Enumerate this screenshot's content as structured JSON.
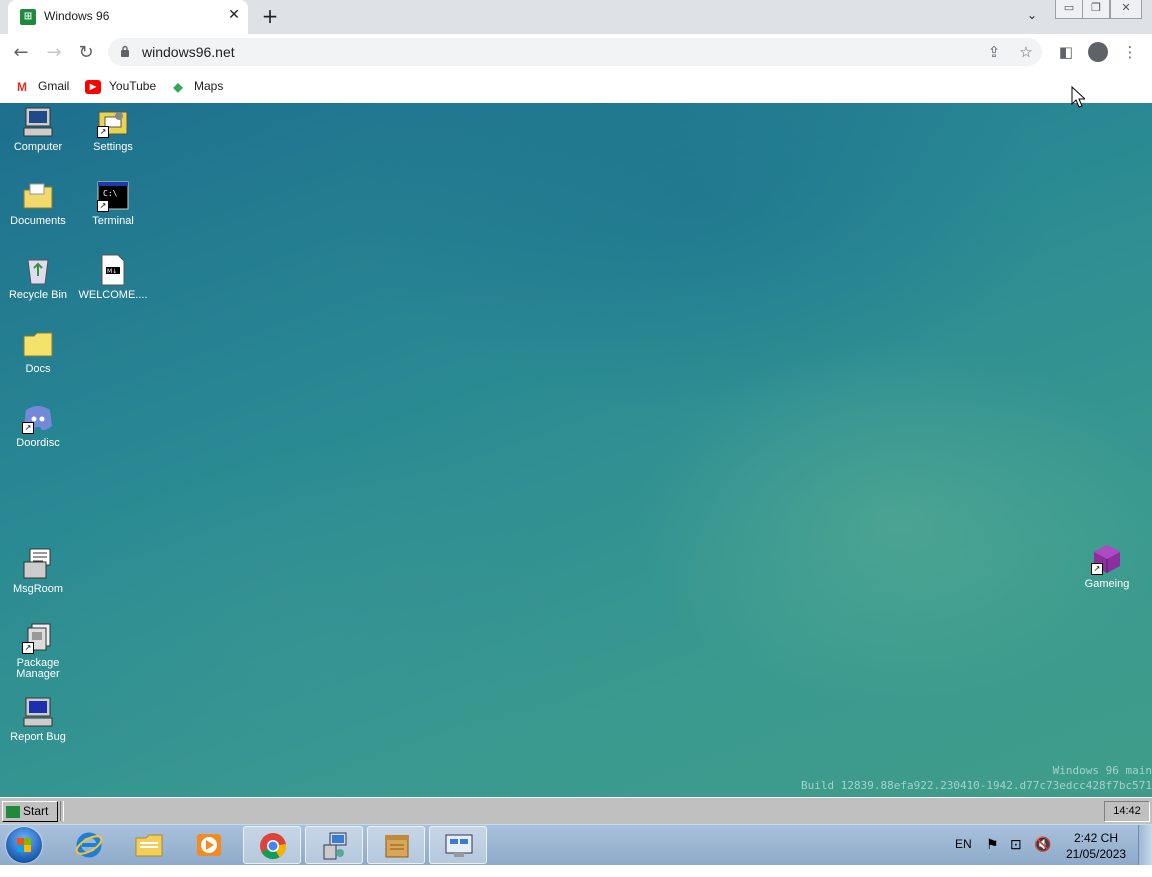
{
  "browser": {
    "tab_title": "Windows 96",
    "tab_close": "✕",
    "new_tab": "+",
    "url": "windows96.net",
    "bookmarks": [
      {
        "label": "Gmail",
        "icon": "gmail-icon"
      },
      {
        "label": "YouTube",
        "icon": "youtube-icon"
      },
      {
        "label": "Maps",
        "icon": "maps-icon"
      }
    ]
  },
  "desktop": {
    "icons": [
      {
        "label": "Computer",
        "icon": "computer-icon"
      },
      {
        "label": "Settings",
        "icon": "settings-icon"
      },
      {
        "label": "Documents",
        "icon": "documents-folder-icon"
      },
      {
        "label": "Terminal",
        "icon": "terminal-icon"
      },
      {
        "label": "Recycle Bin",
        "icon": "recycle-bin-icon"
      },
      {
        "label": "WELCOME....",
        "icon": "markdown-file-icon"
      },
      {
        "label": "Docs",
        "icon": "folder-icon"
      },
      {
        "label": "Doordisc",
        "icon": "discord-icon"
      },
      {
        "label": "MsgRoom",
        "icon": "msgroom-icon"
      },
      {
        "label": "Package Manager",
        "icon": "package-manager-icon"
      },
      {
        "label": "Report Bug",
        "icon": "report-bug-icon"
      },
      {
        "label": "Gameing",
        "icon": "cube-icon"
      }
    ],
    "build_line1": "Windows 96 main",
    "build_line2": "Build 12839.88efa922.230410-1942.d77c73edcc428f7bc571"
  },
  "w96_taskbar": {
    "start_label": "Start",
    "clock": "14:42"
  },
  "win7_taskbar": {
    "apps": [
      "internet-explorer-icon",
      "file-explorer-icon",
      "media-player-icon",
      "chrome-icon",
      "network-setup-icon",
      "archive-icon",
      "remote-desktop-icon"
    ],
    "language": "EN",
    "time": "2:42 CH",
    "date": "21/05/2023"
  },
  "colors": {
    "desktop_teal": "#2a8a93",
    "win96_gray": "#c0c0c0",
    "win7_taskbar": "#9db6d3"
  }
}
